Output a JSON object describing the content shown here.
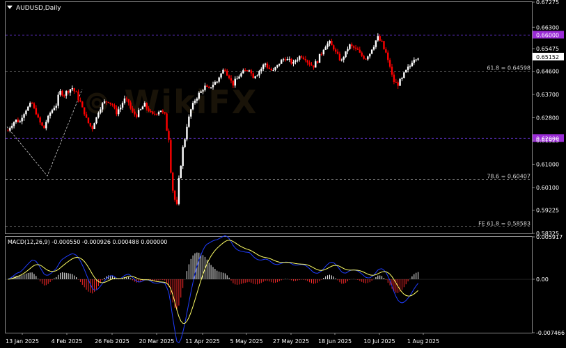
{
  "header": {
    "symbol_label": "AUDUSD,Daily"
  },
  "macd": {
    "label": "MACD(12,26,9) -0.000550 -0.000926 0.000488 0.000000"
  },
  "chart_data": [
    {
      "type": "candlestick",
      "title": "AUDUSD,Daily",
      "ylim": [
        0.58325,
        0.67275
      ],
      "y_ticks": [
        "0.67275",
        "0.66300",
        "0.65475",
        "0.64600",
        "0.63700",
        "0.62800",
        "0.61925",
        "0.61000",
        "0.60100",
        "0.59225",
        "0.58325"
      ],
      "x_ticks": [
        "13 Jan 2025",
        "4 Feb 2025",
        "26 Feb 2025",
        "20 Mar 2025",
        "11 Apr 2025",
        "5 May 2025",
        "27 May 2025",
        "18 Jun 2025",
        "10 Jul 2025",
        "1 Aug 2025"
      ],
      "levels": [
        {
          "value": 0.66,
          "label": "0.66000",
          "style": "purple-dashed",
          "boxed": true,
          "color": "#9a2bd6"
        },
        {
          "value": 0.64598,
          "label": "61.8 = 0.64598",
          "style": "gray-dashed"
        },
        {
          "value": 0.62,
          "label": "0.62000",
          "style": "purple-dashed",
          "boxed": true,
          "color": "#9a2bd6"
        },
        {
          "value": 0.60407,
          "label": "78.6 = 0.60407",
          "style": "gray-dashed"
        },
        {
          "value": 0.58583,
          "label": "FE 61.8 = 0.58583",
          "style": "gray-dashed"
        }
      ],
      "current_price": {
        "value": 0.65152,
        "label": "0.65152"
      },
      "bull_color": "#ffffff",
      "bear_color": "#ff0000",
      "close_path": [
        0.623,
        0.6255,
        0.627,
        0.6265,
        0.63,
        0.632,
        0.6335,
        0.63,
        0.626,
        0.624,
        0.628,
        0.631,
        0.633,
        0.638,
        0.637,
        0.6385,
        0.6395,
        0.6375,
        0.634,
        0.63,
        0.626,
        0.624,
        0.628,
        0.632,
        0.634,
        0.6345,
        0.633,
        0.63,
        0.632,
        0.635,
        0.634,
        0.63,
        0.629,
        0.631,
        0.633,
        0.631,
        0.629,
        0.63,
        0.631,
        0.629,
        0.62,
        0.6,
        0.594,
        0.61,
        0.62,
        0.628,
        0.633,
        0.636,
        0.638,
        0.64,
        0.639,
        0.641,
        0.642,
        0.645,
        0.647,
        0.644,
        0.641,
        0.643,
        0.645,
        0.646,
        0.647,
        0.644,
        0.645,
        0.647,
        0.649,
        0.647,
        0.646,
        0.648,
        0.65,
        0.651,
        0.65,
        0.649,
        0.651,
        0.652,
        0.651,
        0.649,
        0.648,
        0.65,
        0.653,
        0.656,
        0.657,
        0.655,
        0.652,
        0.65,
        0.653,
        0.656,
        0.655,
        0.654,
        0.652,
        0.651,
        0.653,
        0.656,
        0.659,
        0.657,
        0.653,
        0.648,
        0.642,
        0.641,
        0.643,
        0.646,
        0.648,
        0.651,
        0.6515
      ],
      "macd_ylim": [
        -0.007466,
        0.005917
      ],
      "macd_ticks": [
        "0.005917",
        "0.00",
        "-0.007466"
      ],
      "macd_histogram_colors": {
        "positive": "#ffffff",
        "negative": "#ff2a2a"
      },
      "macd_signal_color": "#ffff66",
      "macd_main_color": "#1f3cff"
    }
  ]
}
